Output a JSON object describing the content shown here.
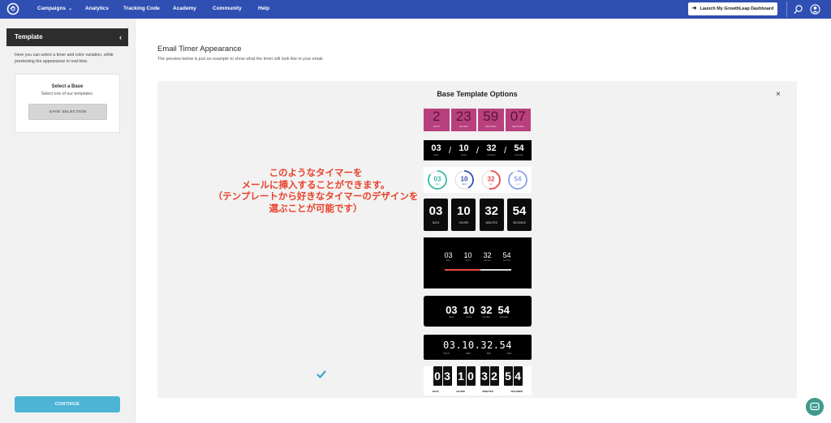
{
  "nav": {
    "items": [
      "Campaigns",
      "Analytics",
      "Tracking Code",
      "Academy",
      "Community",
      "Help"
    ],
    "launch_button": "Launch My GrowthLeap Dashboard"
  },
  "sidebar": {
    "title": "Template",
    "description": "Here you can select a timer and color variation, while previewing the appearance in real time.",
    "base_box": {
      "title": "Select a Base",
      "subtitle": "Select one of our templates.",
      "save_button": "SAVE SELECTION"
    },
    "continue_button": "CONTINUE"
  },
  "main": {
    "title": "Email Timer Appearance",
    "subtitle": "The preview below is just an example to show what the timer will look like in your email.",
    "panel_title": "Base Template Options",
    "close": "×",
    "annotation": [
      "このようなタイマーを",
      "メールに挿入することができます。",
      "（テンプレートから好きなタイマーのデザインを",
      "選ぶことが可能です）"
    ]
  },
  "templates": {
    "t1": {
      "values": [
        "2",
        "23",
        "59",
        "07"
      ],
      "labels": [
        "DAYS",
        "HOURS",
        "MINUTES",
        "SECONDS"
      ]
    },
    "t2": {
      "values": [
        "03",
        "10",
        "32",
        "54"
      ],
      "labels": [
        "days",
        "hours",
        "minutes",
        "seconds"
      ]
    },
    "t3": {
      "values": [
        "03",
        "10",
        "32",
        "54"
      ],
      "labels": [
        "days",
        "hours",
        "min",
        "secs"
      ],
      "fill": [
        0.85,
        0.42,
        0.53,
        0.9
      ]
    },
    "t4": {
      "values": [
        "03",
        "10",
        "32",
        "54"
      ],
      "labels": [
        "DAYS",
        "HOURS",
        "MINUTES",
        "SECONDS"
      ]
    },
    "t5": {
      "values": [
        "03",
        "10",
        "32",
        "54"
      ],
      "labels": [
        "days",
        "hours",
        "minutes",
        "seconds"
      ]
    },
    "t6": {
      "values": [
        "03",
        "10",
        "32",
        "54"
      ],
      "labels": [
        "days",
        "hours",
        "minutes",
        "seconds"
      ]
    },
    "t7": {
      "values": "03.10.32.54",
      "labels": [
        "DAYS",
        "HRS",
        "MIN",
        "SEC"
      ]
    },
    "t8": {
      "digits": [
        "0",
        "3",
        "1",
        "0",
        "3",
        "2",
        "5",
        "4"
      ],
      "labels": [
        "DAYS",
        "HOURS",
        "MINUTES",
        "SECONDS"
      ]
    }
  },
  "colors": {
    "nav_bg": "#2f4fb3",
    "pink_timer": "#b8407e",
    "annotation_red": "#e8412b",
    "continue_bg": "#4db4d6",
    "ring_colors": [
      "#3bb6a8",
      "#2f4fb3",
      "#e84a4a",
      "#8aa0e8"
    ]
  },
  "icons": [
    "logo-icon",
    "search-icon",
    "account-icon",
    "check-icon",
    "chat-icon",
    "chevron-left-icon",
    "chevron-down-icon",
    "arrow-icon"
  ]
}
